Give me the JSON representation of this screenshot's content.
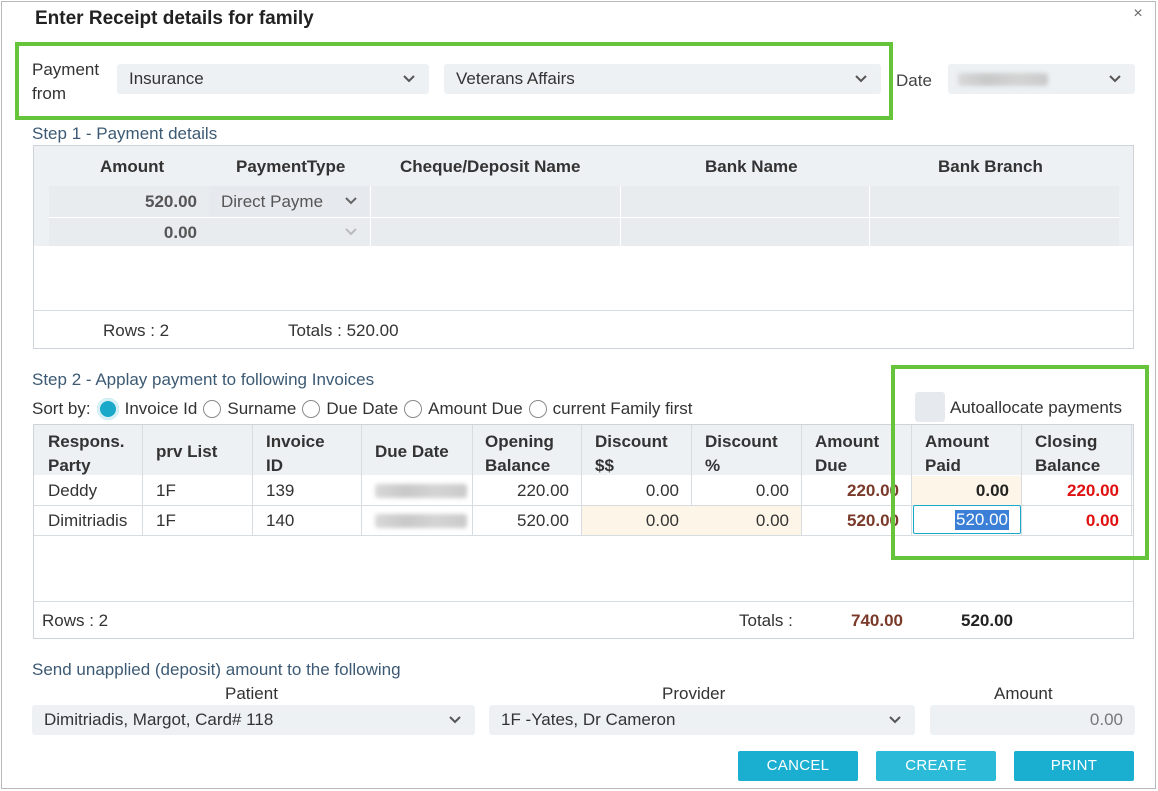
{
  "dialog": {
    "title": "Enter Receipt details for family",
    "close_glyph": "×"
  },
  "payment_from": {
    "label_line1": "Payment",
    "label_line2": "from",
    "source": "Insurance",
    "payer": "Veterans Affairs",
    "date_label": "Date"
  },
  "step1": {
    "label": "Step 1 - Payment details",
    "columns": [
      "Amount",
      "PaymentType",
      "Cheque/Deposit Name",
      "Bank Name",
      "Bank Branch"
    ],
    "rows": [
      {
        "amount": "520.00",
        "payment_type": "Direct Payme"
      },
      {
        "amount": "0.00",
        "payment_type": ""
      }
    ],
    "rows_label": "Rows : 2",
    "totals_label": "Totals : 520.00"
  },
  "step2": {
    "label": "Step 2 - Applay payment to following Invoices",
    "sort_by": "Sort by:",
    "sort_options": [
      "Invoice Id",
      "Surname",
      "Due Date",
      "Amount Due",
      "current Family first"
    ],
    "autoallocate_label": "Autoallocate payments",
    "headers": {
      "resp_1": "Respons.",
      "resp_2": "Party",
      "prv": "prv List",
      "inv_1": "Invoice",
      "inv_2": "ID",
      "due_date": "Due Date",
      "open_1": "Opening",
      "open_2": "Balance",
      "disc_1": "Discount",
      "disc_2": "$$",
      "discp_1": "Discount",
      "discp_2": "%",
      "amt_due_1": "Amount",
      "amt_due_2": "Due",
      "amt_paid_1": "Amount",
      "amt_paid_2": "Paid",
      "closing_1": "Closing",
      "closing_2": "Balance"
    },
    "rows": [
      {
        "party": "Deddy",
        "prv": "1F",
        "invoice": "139",
        "opening": "220.00",
        "discount": "0.00",
        "discount_pct": "0.00",
        "amount_due": "220.00",
        "amount_paid": "0.00",
        "closing": "220.00"
      },
      {
        "party": "Dimitriadis",
        "prv": "1F",
        "invoice": "140",
        "opening": "520.00",
        "discount": "0.00",
        "discount_pct": "0.00",
        "amount_due": "520.00",
        "amount_paid": "520.00",
        "closing": "0.00"
      }
    ],
    "rows_label": "Rows : 2",
    "totals_label": "Totals :",
    "total_due": "740.00",
    "total_paid": "520.00"
  },
  "deposit": {
    "label": "Send unapplied (deposit) amount to the following",
    "patient_label": "Patient",
    "provider_label": "Provider",
    "amount_label": "Amount",
    "patient": "Dimitriadis, Margot, Card# 118",
    "provider": "1F -Yates, Dr Cameron",
    "amount": "0.00"
  },
  "buttons": {
    "cancel": "CANCEL",
    "create": "CREATE",
    "print": "PRINT"
  },
  "colors": {
    "accent": "#1aaed0",
    "highlight": "#66c43a",
    "amount_due": "#7a3a2a",
    "closing_red": "#e01010"
  }
}
